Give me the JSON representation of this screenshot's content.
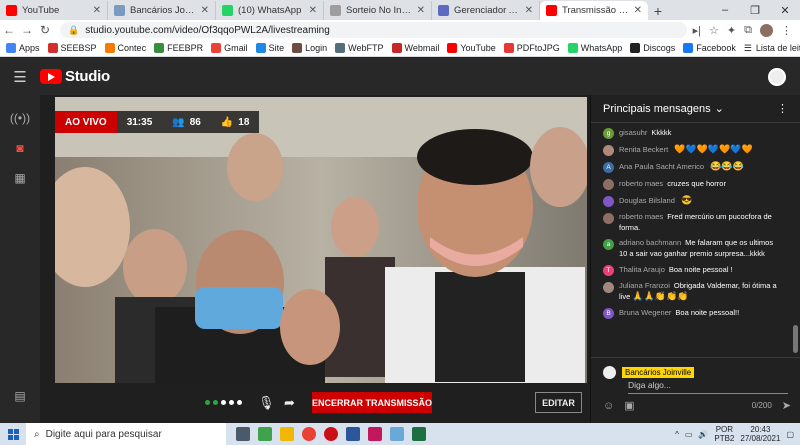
{
  "browser": {
    "tabs": [
      {
        "title": "YouTube",
        "icon": "youtube-icon",
        "color": "#ff0000",
        "active": false
      },
      {
        "title": "Bancários Joinville – S",
        "icon": "site-icon",
        "color": "#7a9bbf",
        "active": false
      },
      {
        "title": "(10) WhatsApp",
        "icon": "whatsapp-icon",
        "color": "#25d366",
        "active": false
      },
      {
        "title": "Sorteio No Instagram",
        "icon": "page-icon",
        "color": "#9e9e9e",
        "active": false
      },
      {
        "title": "Gerenciador Administ",
        "icon": "page-icon",
        "color": "#5c6bc0",
        "active": false
      },
      {
        "title": "Transmissão ao vi",
        "icon": "youtube-icon",
        "color": "#ff0000",
        "active": true
      }
    ],
    "url": "studio.youtube.com/video/Of3qqoPWL2A/livestreaming",
    "bookmarks": [
      {
        "label": "Apps",
        "color": "#4285f4"
      },
      {
        "label": "SEEBSP",
        "color": "#d32f2f"
      },
      {
        "label": "Contec",
        "color": "#f57c00"
      },
      {
        "label": "FEEBPR",
        "color": "#388e3c"
      },
      {
        "label": "Gmail",
        "color": "#ea4335"
      },
      {
        "label": "Site",
        "color": "#1e88e5"
      },
      {
        "label": "Login",
        "color": "#6d4c41"
      },
      {
        "label": "WebFTP",
        "color": "#546e7a"
      },
      {
        "label": "Webmail",
        "color": "#c62828"
      },
      {
        "label": "YouTube",
        "color": "#ff0000"
      },
      {
        "label": "PDFtoJPG",
        "color": "#e53935"
      },
      {
        "label": "WhatsApp",
        "color": "#25d366"
      },
      {
        "label": "Discogs",
        "color": "#212121"
      },
      {
        "label": "Facebook",
        "color": "#1877f2"
      }
    ],
    "reading_list": "Lista de leitura"
  },
  "studio": {
    "logo_text": "Studio",
    "live_badge": "AO VIVO",
    "duration": "31:35",
    "viewers": "86",
    "likes": "18",
    "end_button": "ENCERRAR TRANSMISSÃO",
    "edit_button": "EDITAR"
  },
  "chat": {
    "title": "Principais mensagens",
    "messages": [
      {
        "name": "gisasuhr",
        "text": "Kkkkk",
        "emoji": "",
        "avatar_color": "#6a9a3a",
        "initial": "g"
      },
      {
        "name": "Renita Beckert",
        "text": "",
        "emoji": "🧡💙🧡💙🧡💙🧡",
        "avatar_color": "#b0897a",
        "initial": ""
      },
      {
        "name": "Ana Paula Sacht Americo",
        "text": "",
        "emoji": "😂😂😂",
        "avatar_color": "#3b6ea5",
        "initial": "A"
      },
      {
        "name": "roberto maes",
        "text": "cruzes que horror",
        "emoji": "",
        "avatar_color": "#8d6e63",
        "initial": ""
      },
      {
        "name": "Douglas Bilsland",
        "text": "",
        "emoji": "😎",
        "avatar_color": "#7e57c2",
        "initial": ""
      },
      {
        "name": "roberto maes",
        "text": "Fred mercúrio um pucocfora de forma.",
        "emoji": "",
        "avatar_color": "#8d6e63",
        "initial": ""
      },
      {
        "name": "adriano bachmann",
        "text": "Me falaram que os ultimos 10 a sair vao ganhar premio surpresa...kkkk",
        "emoji": "",
        "avatar_color": "#43a047",
        "initial": "a"
      },
      {
        "name": "Thalita Araujo",
        "text": "Boa noite pessoal !",
        "emoji": "",
        "avatar_color": "#ec407a",
        "initial": "T"
      },
      {
        "name": "Juliana Franzoi",
        "text": "Obrigada Valdemar, foi ótima a live",
        "emoji": "🙏🙏👏👏👏",
        "avatar_color": "#a1887f",
        "initial": ""
      },
      {
        "name": "Bruna Wegener",
        "text": "Boa noite pessoal!!",
        "emoji": "",
        "avatar_color": "#7e57c2",
        "initial": "B"
      }
    ],
    "input_user": "Bancários Joinville",
    "input_placeholder": "Diga algo...",
    "char_count": "0/200"
  },
  "taskbar": {
    "search_placeholder": "Digite aqui para pesquisar",
    "lang_top": "POR",
    "lang_bottom": "PTB2",
    "time": "20:43",
    "date": "27/08/2021"
  }
}
